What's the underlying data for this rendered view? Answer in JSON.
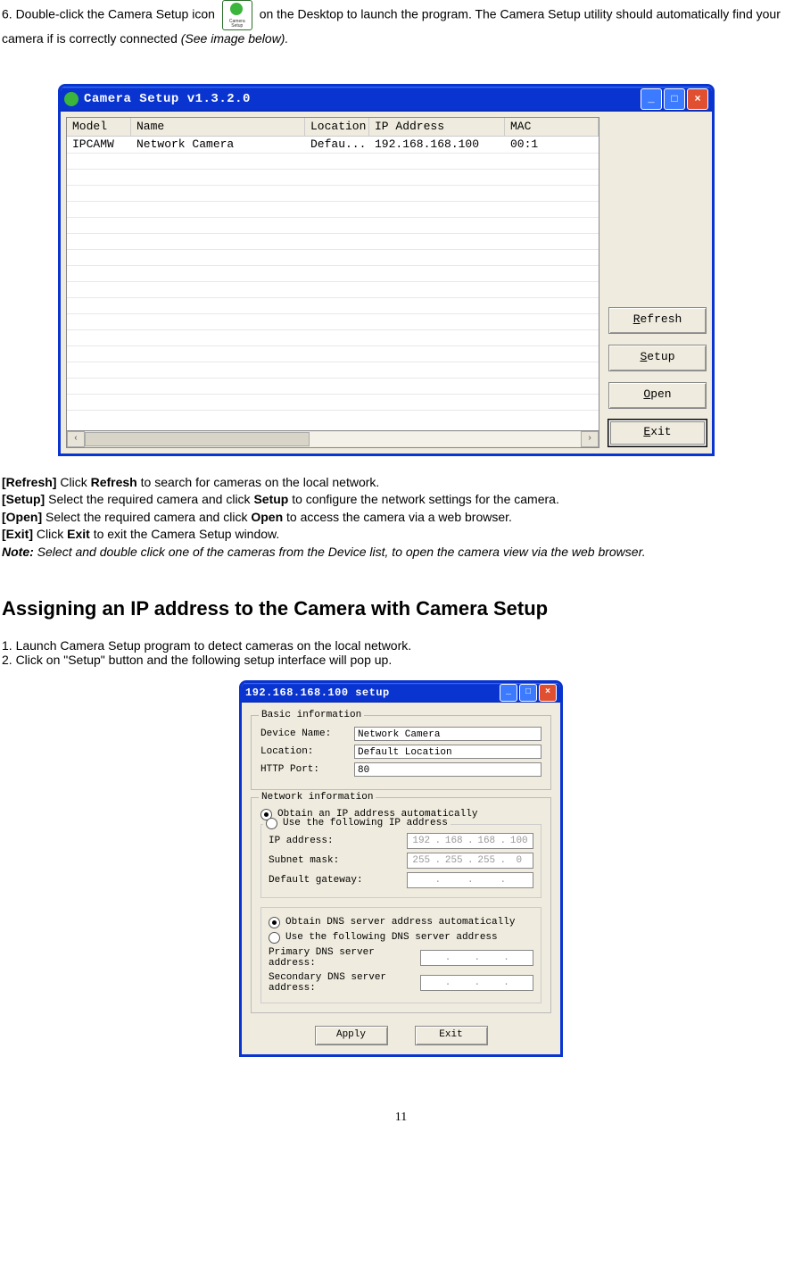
{
  "intro": {
    "line1a": "6. Double-click the Camera Setup icon ",
    "line1b": " on the Desktop to launch the program. The Camera Setup utility should automatically find your camera if is correctly connected ",
    "line1c": "(See image below).",
    "see_image": "(See image below)"
  },
  "window1": {
    "title": "Camera Setup v1.3.2.0",
    "headers": {
      "model": "Model",
      "name": "Name",
      "location": "Location",
      "ip": "IP Address",
      "mac": "MAC"
    },
    "row": {
      "model": "IPCAMW",
      "name": "Network Camera",
      "location": "Defau...",
      "ip": "192.168.168.100",
      "mac": "00:1"
    },
    "buttons": {
      "refresh": "Refresh",
      "refresh_u": "R",
      "setup": "Setup",
      "setup_u": "S",
      "open": "Open",
      "open_u": "O",
      "exit": "Exit",
      "exit_u": "E"
    }
  },
  "desc": {
    "refresh_b": "[Refresh]",
    "refresh_t1": " Click ",
    "refresh_m": "Refresh",
    "refresh_t2": " to search for cameras on the local network.",
    "setup_b": "[Setup]",
    "setup_t1": " Select the required camera and click ",
    "setup_m": "Setup",
    "setup_t2": " to configure the network settings for the camera.",
    "open_b": "[Open]",
    "open_t1": " Select the required camera and click ",
    "open_m": "Open",
    "open_t2": " to access the camera via a web browser.",
    "exit_b": "[Exit]",
    "exit_t1": " Click ",
    "exit_m": "Exit",
    "exit_t2": " to exit the Camera Setup window.",
    "note_b": "Note:",
    "note_t": " Select and double click one of the cameras from the Device list, to open the camera view via the web browser."
  },
  "section_heading": "Assigning an IP address to the Camera with Camera Setup",
  "steps": {
    "s1": "1. Launch Camera Setup program to detect cameras on the local network.",
    "s2": "2. Click on \"Setup\" button and the following setup interface will pop up."
  },
  "window2": {
    "title": "192.168.168.100 setup",
    "basic": {
      "legend": "Basic information",
      "device_label": "Device Name:",
      "device_value": "Network Camera",
      "location_label": "Location:",
      "location_value": "Default Location",
      "http_label": "HTTP Port:",
      "http_value": "80"
    },
    "net": {
      "legend": "Network information",
      "radio_auto": "Obtain an IP address automatically",
      "radio_use": "Use the following IP address",
      "ip_label": "IP address:",
      "ip_value": [
        "192",
        "168",
        "168",
        "100"
      ],
      "mask_label": "Subnet mask:",
      "mask_value": [
        "255",
        "255",
        "255",
        "0"
      ],
      "gw_label": "Default gateway:",
      "gw_value": [
        "",
        "",
        "",
        ""
      ],
      "radio_dns_auto": "Obtain DNS server address automatically",
      "radio_dns_use": "Use the following DNS server address",
      "pdns_label": "Primary DNS server address:",
      "sdns_label": "Secondary DNS server address:"
    },
    "buttons": {
      "apply": "Apply",
      "exit": "Exit"
    }
  },
  "pagenum": "11"
}
